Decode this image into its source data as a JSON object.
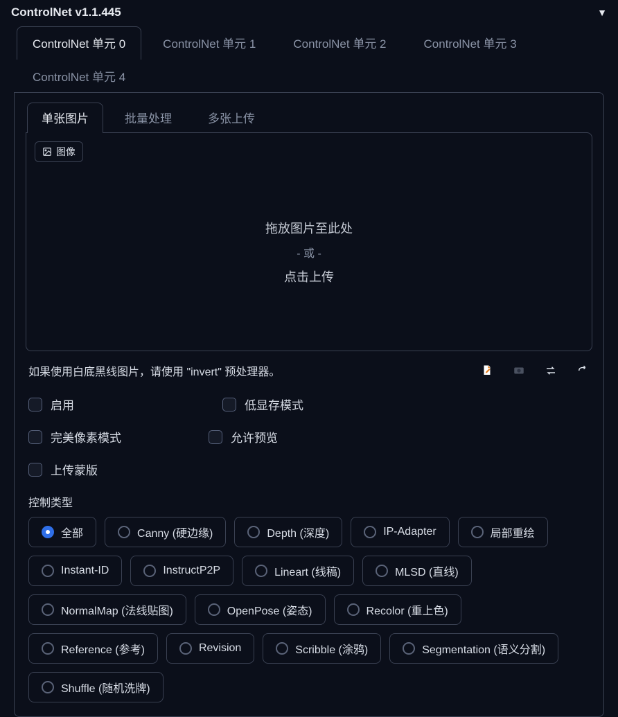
{
  "header": {
    "title": "ControlNet v1.1.445"
  },
  "unit_tabs": [
    "ControlNet 单元 0",
    "ControlNet 单元 1",
    "ControlNet 单元 2",
    "ControlNet 单元 3",
    "ControlNet 单元 4"
  ],
  "sub_tabs": [
    "单张图片",
    "批量处理",
    "多张上传"
  ],
  "image_badge": "图像",
  "dropzone": {
    "line1": "拖放图片至此处",
    "sep": "- 或 -",
    "line2": "点击上传"
  },
  "hint": "如果使用白底黑线图片，请使用 \"invert\" 预处理器。",
  "checkboxes": {
    "enable": "启用",
    "low_vram": "低显存模式",
    "pixel_perfect": "完美像素模式",
    "allow_preview": "允许预览",
    "upload_mask": "上传蒙版"
  },
  "control_type_label": "控制类型",
  "control_types": [
    "全部",
    "Canny (硬边缘)",
    "Depth (深度)",
    "IP-Adapter",
    "局部重绘",
    "Instant-ID",
    "InstructP2P",
    "Lineart (线稿)",
    "MLSD (直线)",
    "NormalMap (法线贴图)",
    "OpenPose (姿态)",
    "Recolor (重上色)",
    "Reference (参考)",
    "Revision",
    "Scribble (涂鸦)",
    "Segmentation (语义分割)",
    "Shuffle (随机洗牌)"
  ]
}
